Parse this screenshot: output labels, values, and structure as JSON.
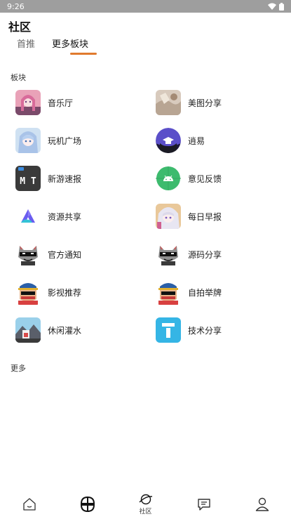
{
  "status_bar": {
    "time": "9:26"
  },
  "header": {
    "title": "社区"
  },
  "tabs": [
    {
      "label": "首推"
    },
    {
      "label": "更多板块"
    }
  ],
  "sections": {
    "boards_label": "板块",
    "more_label": "更多"
  },
  "boards": [
    {
      "label": "音乐厅",
      "icon": "anime-girl-pink-icon"
    },
    {
      "label": "美图分享",
      "icon": "photo-cat-icon"
    },
    {
      "label": "玩机广场",
      "icon": "anime-girl-blue-icon"
    },
    {
      "label": "逍易",
      "icon": "graduation-cap-icon"
    },
    {
      "label": "新游速报",
      "icon": "mt-logo-icon"
    },
    {
      "label": "意见反馈",
      "icon": "android-icon"
    },
    {
      "label": "资源共享",
      "icon": "aliyun-drive-icon"
    },
    {
      "label": "每日早报",
      "icon": "anime-girl-silver-icon"
    },
    {
      "label": "官方通知",
      "icon": "raccoon-sunglasses-icon"
    },
    {
      "label": "源码分享",
      "icon": "raccoon-sunglasses-icon"
    },
    {
      "label": "影视推荐",
      "icon": "cartoon-dog-cap-icon"
    },
    {
      "label": "自拍举牌",
      "icon": "cartoon-dog-cap-icon"
    },
    {
      "label": "休闲灌水",
      "icon": "cartoon-landscape-icon"
    },
    {
      "label": "技术分享",
      "icon": "info-i-icon"
    }
  ],
  "bottom_nav": [
    {
      "label": "",
      "icon": "home-icon"
    },
    {
      "label": "",
      "icon": "grid-apps-icon"
    },
    {
      "label": "社区",
      "icon": "planet-icon"
    },
    {
      "label": "",
      "icon": "message-icon"
    },
    {
      "label": "",
      "icon": "profile-icon"
    }
  ],
  "colors": {
    "accent": "#e07a2e",
    "status_bar": "#9e9e9e"
  }
}
